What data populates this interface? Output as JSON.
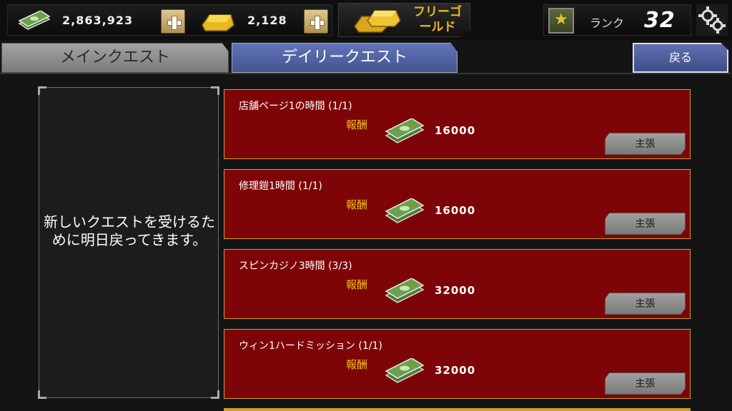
{
  "currency": {
    "cash": "2,863,923",
    "gold": "2,128",
    "free_gold_label": "フリーゴールド"
  },
  "rank": {
    "label": "ランク",
    "value": "32"
  },
  "tabs": [
    {
      "label": "メインクエスト",
      "active": false
    },
    {
      "label": "デイリークエスト",
      "active": true
    }
  ],
  "back_label": "戻る",
  "info_message": "新しいクエストを受けるために明日戻ってきます。",
  "quests": [
    {
      "title": "店舗ページ1の時間 (1/1)",
      "reward_label": "報酬",
      "reward": "16000",
      "claim_label": "主張"
    },
    {
      "title": "修理鎧1時間 (1/1)",
      "reward_label": "報酬",
      "reward": "16000",
      "claim_label": "主張"
    },
    {
      "title": "スピンカジノ3時間 (3/3)",
      "reward_label": "報酬",
      "reward": "32000",
      "claim_label": "主張"
    },
    {
      "title": "ウィン1ハードミッション (1/1)",
      "reward_label": "報酬",
      "reward": "32000",
      "claim_label": "主張"
    }
  ],
  "colors": {
    "card_bg": "#7e0507",
    "card_border": "#c9a030",
    "active_tab": "#5566aa",
    "reward_label": "#f3c020"
  }
}
